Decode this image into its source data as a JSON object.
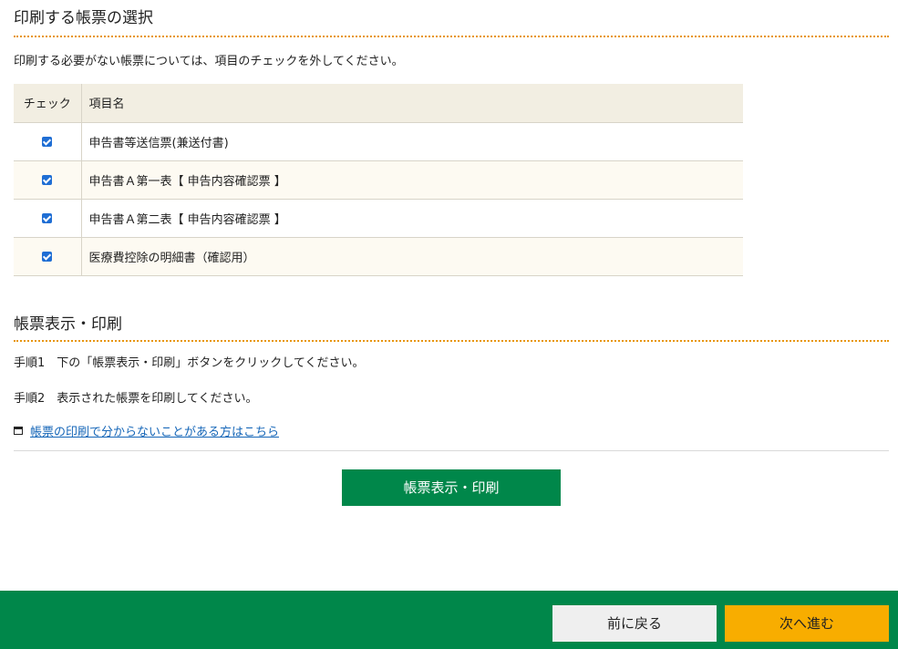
{
  "section1": {
    "title": "印刷する帳票の選択",
    "instruction": "印刷する必要がない帳票については、項目のチェックを外してください。",
    "table": {
      "headers": [
        "チェック",
        "項目名"
      ],
      "rows": [
        {
          "label": "申告書等送信票(兼送付書)",
          "checked": true
        },
        {
          "label": "申告書Ａ第一表【 申告内容確認票 】",
          "checked": true
        },
        {
          "label": "申告書Ａ第二表【 申告内容確認票 】",
          "checked": true
        },
        {
          "label": "医療費控除の明細書（確認用）",
          "checked": true
        }
      ]
    }
  },
  "section2": {
    "title": "帳票表示・印刷",
    "step1": "手順1　下の「帳票表示・印刷」ボタンをクリックしてください。",
    "step2": "手順2　表示された帳票を印刷してください。",
    "help_link": "帳票の印刷で分からないことがある方はこちら",
    "print_button": "帳票表示・印刷"
  },
  "footer": {
    "back_button": "前に戻る",
    "next_button": "次へ進む"
  },
  "colors": {
    "primary_green": "#00874a",
    "accent_orange": "#f8ad00",
    "dotted_rule": "#e8960c",
    "link_blue": "#1566b8",
    "checkbox_blue": "#1f6ed4"
  }
}
